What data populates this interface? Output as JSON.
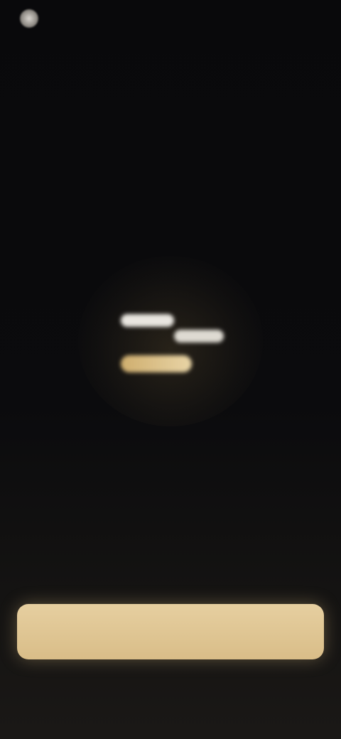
{
  "status_bar": {
    "time": ""
  },
  "hero": {
    "icon": "lit-text-logo-icon",
    "accent_color": "#d9bd88"
  },
  "title": "",
  "subtitle": "",
  "primary_button": {
    "label": ""
  },
  "secondary_link": {
    "label": ""
  }
}
